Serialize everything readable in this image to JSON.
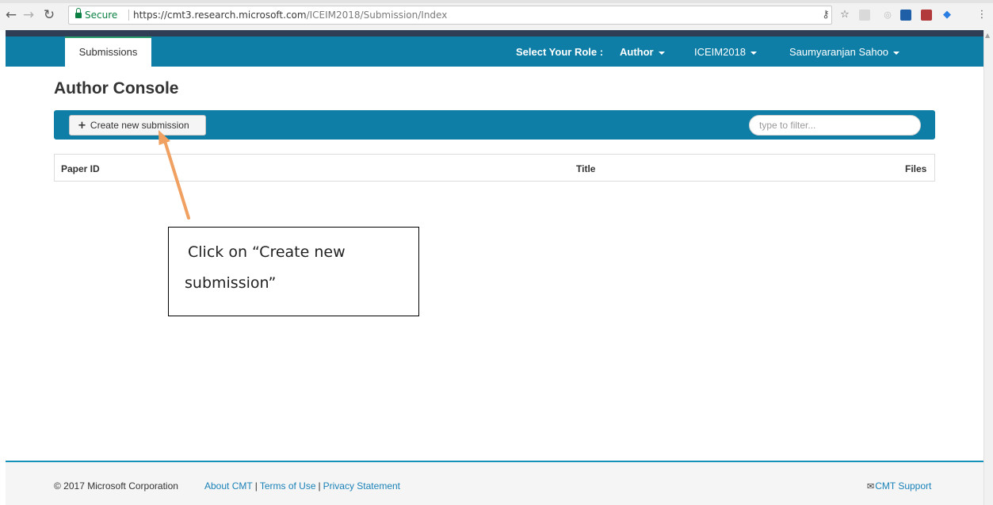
{
  "browser": {
    "secure_label": "Secure",
    "url_host": "https://cmt3.research.microsoft.com",
    "url_path": "/ICEIM2018/Submission/Index"
  },
  "navbar": {
    "tab_label": "Submissions",
    "role_label": "Select Your Role :",
    "role_value": "Author",
    "conference": "ICEIM2018",
    "user": "Saumyaranjan Sahoo"
  },
  "main": {
    "title": "Author Console",
    "create_button": "Create new submission",
    "filter_placeholder": "type to filter...",
    "table": {
      "columns": [
        "Paper ID",
        "Title",
        "Files"
      ],
      "rows": []
    }
  },
  "annotation": {
    "line1": "Click on “Create new",
    "line2": "submission”",
    "arrow_color": "#f0a060"
  },
  "footer": {
    "copyright": "© 2017 Microsoft Corporation",
    "links": [
      "About CMT",
      "Terms of Use",
      "Privacy Statement"
    ],
    "support": "CMT Support"
  },
  "colors": {
    "brand_teal": "#0e7ea6",
    "top_strip": "#2f3d55",
    "link": "#1a82b8",
    "secure_green": "#0b8043"
  },
  "icons": [
    "back-icon",
    "forward-icon",
    "reload-icon",
    "lock-icon",
    "key-icon",
    "star-icon",
    "plus-icon",
    "caret-down-icon",
    "envelope-icon"
  ]
}
